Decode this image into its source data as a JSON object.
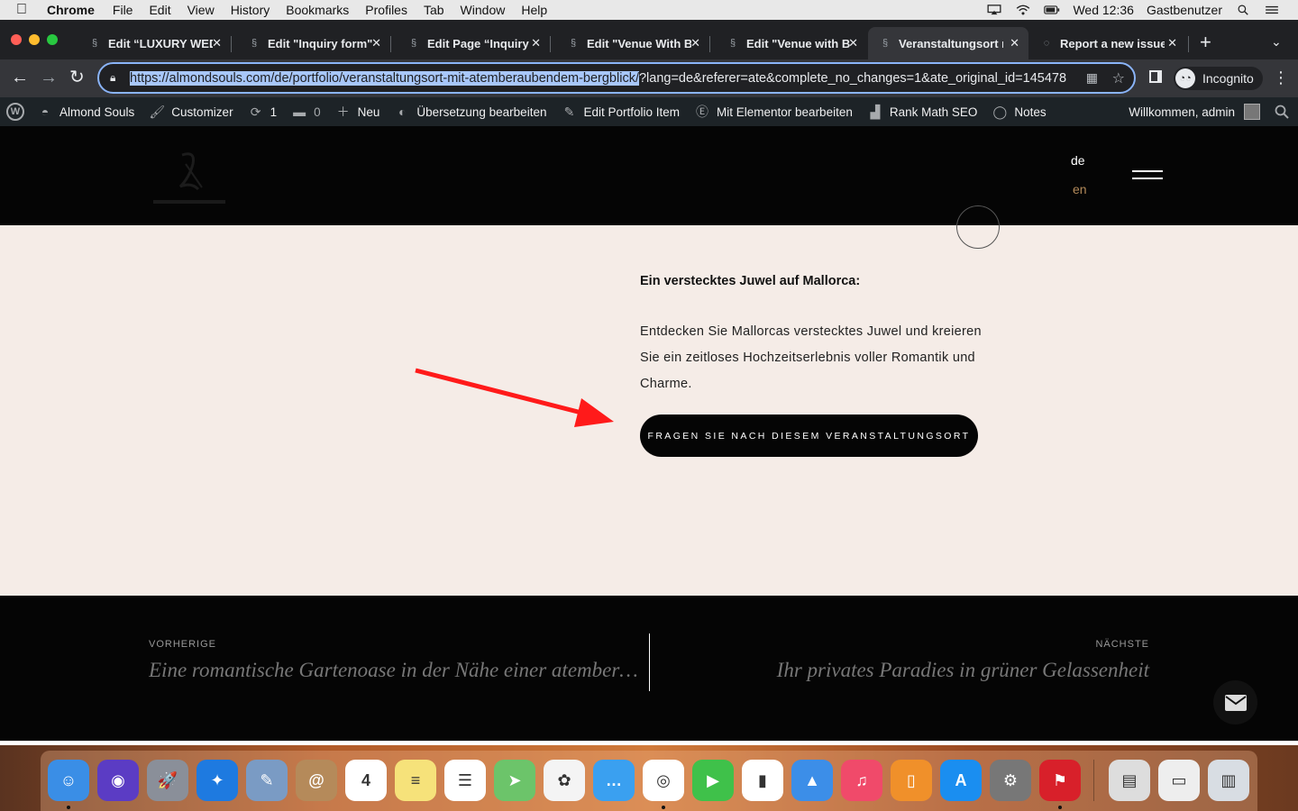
{
  "menubar": {
    "app": "Chrome",
    "items": [
      "File",
      "Edit",
      "View",
      "History",
      "Bookmarks",
      "Profiles",
      "Tab",
      "Window",
      "Help"
    ],
    "clock": "Wed 12:36",
    "user": "Gastbenutzer"
  },
  "tabs": [
    {
      "title": "Edit “LUXURY WEDDING”"
    },
    {
      "title": "Edit \"Inquiry form\" ‹ Almond"
    },
    {
      "title": "Edit Page “Inquiry form”"
    },
    {
      "title": "Edit \"Venue With Breathtaking\""
    },
    {
      "title": "Edit \"Venue with Breathtaking\""
    },
    {
      "title": "Veranstaltungsort mit"
    },
    {
      "title": "Report a new issue"
    }
  ],
  "omnibox": {
    "url_selected": "https://almondsouls.com/de/portfolio/veranstaltungsort-mit-atemberaubendem-bergblick/",
    "url_rest": "?lang=de&referer=ate&complete_no_changes=1&ate_original_id=145478"
  },
  "profile": {
    "label": "Incognito"
  },
  "wpbar": {
    "site": "Almond Souls",
    "customizer": "Customizer",
    "updates": "1",
    "comments": "0",
    "new": "Neu",
    "translate": "Übersetzung bearbeiten",
    "edit_portfolio": "Edit Portfolio Item",
    "elementor": "Mit Elementor bearbeiten",
    "rankmath": "Rank Math SEO",
    "notes": "Notes",
    "welcome": "Willkommen, admin"
  },
  "header": {
    "lang_de": "de",
    "lang_en": "en"
  },
  "content": {
    "heading": "Ein verstecktes Juwel auf Mallorca:",
    "text": "Entdecken Sie Mallorcas verstecktes Juwel und kreieren Sie ein zeitloses Hochzeitserlebnis voller Romantik und Charme.",
    "cta": "FRAGEN SIE NACH DIESEM VERANSTALTUNGSORT"
  },
  "post_nav": {
    "prev_label": "VORHERIGE",
    "prev_title": "Eine romantische Gartenoase in der Nähe einer atemberaubenden Aussicht",
    "next_label": "NÄCHSTE",
    "next_title": "Ihr privates Paradies in grüner Gelassenheit"
  },
  "dock": {
    "icons": [
      {
        "name": "finder",
        "glyph": "☺",
        "color": "#3a8ee6"
      },
      {
        "name": "siri",
        "glyph": "◉",
        "color": "#5b3cc4"
      },
      {
        "name": "launchpad",
        "glyph": "🚀",
        "color": "#8a8f99"
      },
      {
        "name": "safari",
        "glyph": "✦",
        "color": "#1e7ae0"
      },
      {
        "name": "preview",
        "glyph": "✎",
        "color": "#7a9bc4"
      },
      {
        "name": "contacts",
        "glyph": "@",
        "color": "#b58a5a"
      },
      {
        "name": "calendar",
        "glyph": "4",
        "color": "#ffffff"
      },
      {
        "name": "notes",
        "glyph": "≡",
        "color": "#f6e27a"
      },
      {
        "name": "reminders",
        "glyph": "☰",
        "color": "#ffffff"
      },
      {
        "name": "maps",
        "glyph": "➤",
        "color": "#6cc46a"
      },
      {
        "name": "photos",
        "glyph": "✿",
        "color": "#f4f4f4"
      },
      {
        "name": "messages",
        "glyph": "…",
        "color": "#3aa0f0"
      },
      {
        "name": "chrome",
        "glyph": "◎",
        "color": "#ffffff"
      },
      {
        "name": "facetime",
        "glyph": "▶",
        "color": "#3fc14a"
      },
      {
        "name": "numbers",
        "glyph": "▮",
        "color": "#ffffff"
      },
      {
        "name": "keynote",
        "glyph": "▲",
        "color": "#3c8ee8"
      },
      {
        "name": "music",
        "glyph": "♫",
        "color": "#f04a6a"
      },
      {
        "name": "books",
        "glyph": "▯",
        "color": "#f0902a"
      },
      {
        "name": "app-store",
        "glyph": "A",
        "color": "#1a8ef0"
      },
      {
        "name": "system-preferences",
        "glyph": "⚙",
        "color": "#777777"
      },
      {
        "name": "acrobat",
        "glyph": "⚑",
        "color": "#d8202a"
      },
      {
        "name": "document-stack",
        "glyph": "▤",
        "color": "#dddddd"
      },
      {
        "name": "pdf-stack",
        "glyph": "▭",
        "color": "#eeeeee"
      },
      {
        "name": "trash",
        "glyph": "▥",
        "color": "#d8dde3"
      }
    ]
  }
}
